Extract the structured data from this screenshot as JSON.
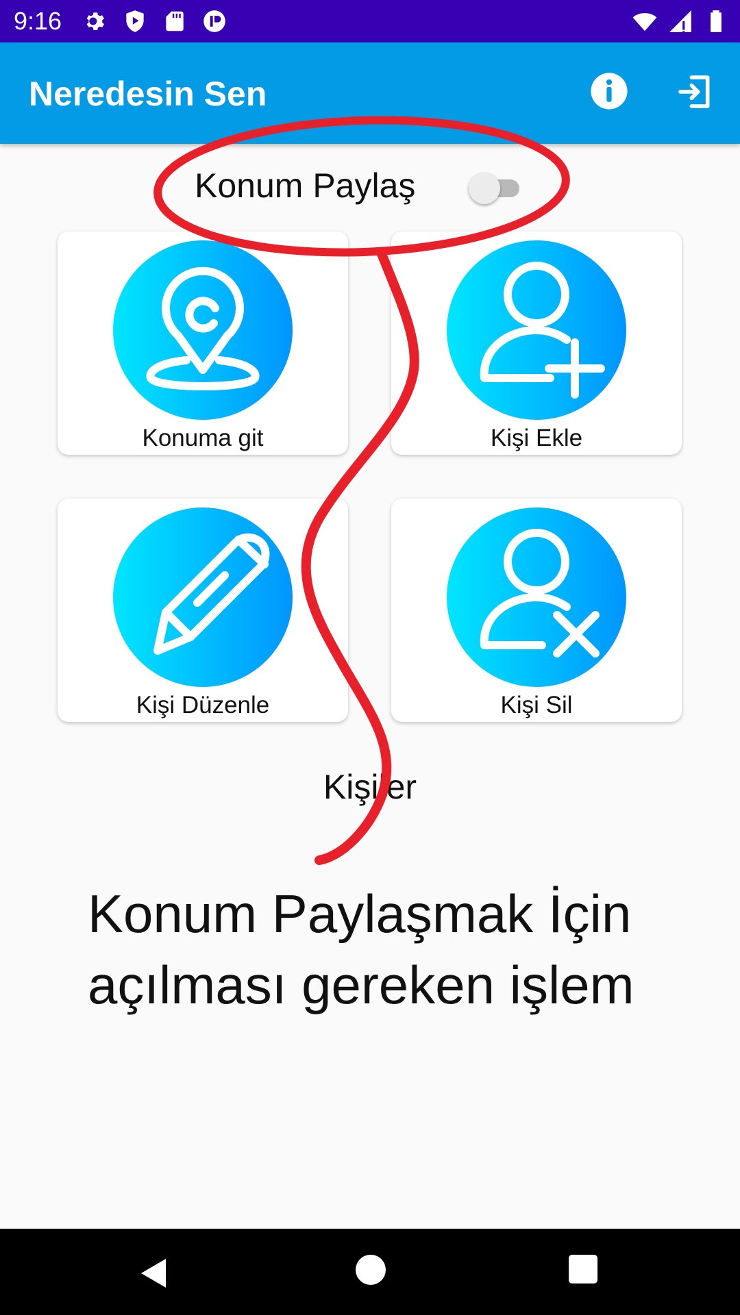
{
  "status_bar": {
    "time": "9:16",
    "left_icons": [
      "gear-icon",
      "play-protect-icon",
      "sd-card-icon",
      "app-notification-icon"
    ],
    "right_icons": [
      "wifi-icon",
      "cellular-signal-icon",
      "battery-icon"
    ]
  },
  "app_bar": {
    "title": "Neredesin Sen",
    "actions": [
      "info-icon",
      "logout-icon"
    ]
  },
  "location_share": {
    "label": "Konum Paylaş",
    "enabled": false
  },
  "menu_cards": [
    {
      "label": "Konuma git",
      "icon": "map-pin-icon"
    },
    {
      "label": "Kişi Ekle",
      "icon": "add-user-icon"
    },
    {
      "label": "Kişi Düzenle",
      "icon": "pencil-icon"
    },
    {
      "label": "Kişi Sil",
      "icon": "remove-user-icon"
    }
  ],
  "contacts_title": "Kişiler",
  "annotation": {
    "note": "Konum Paylaşmak İçin açılması gereken işlem",
    "color": "#e8202a"
  },
  "colors": {
    "status_bar": "#3700b3",
    "app_bar": "#039be5",
    "icon_gradient_start": "#00e5ff",
    "icon_gradient_end": "#0096ff"
  },
  "nav_bar": {
    "buttons": [
      "back-icon",
      "home-icon",
      "recent-apps-icon"
    ]
  }
}
